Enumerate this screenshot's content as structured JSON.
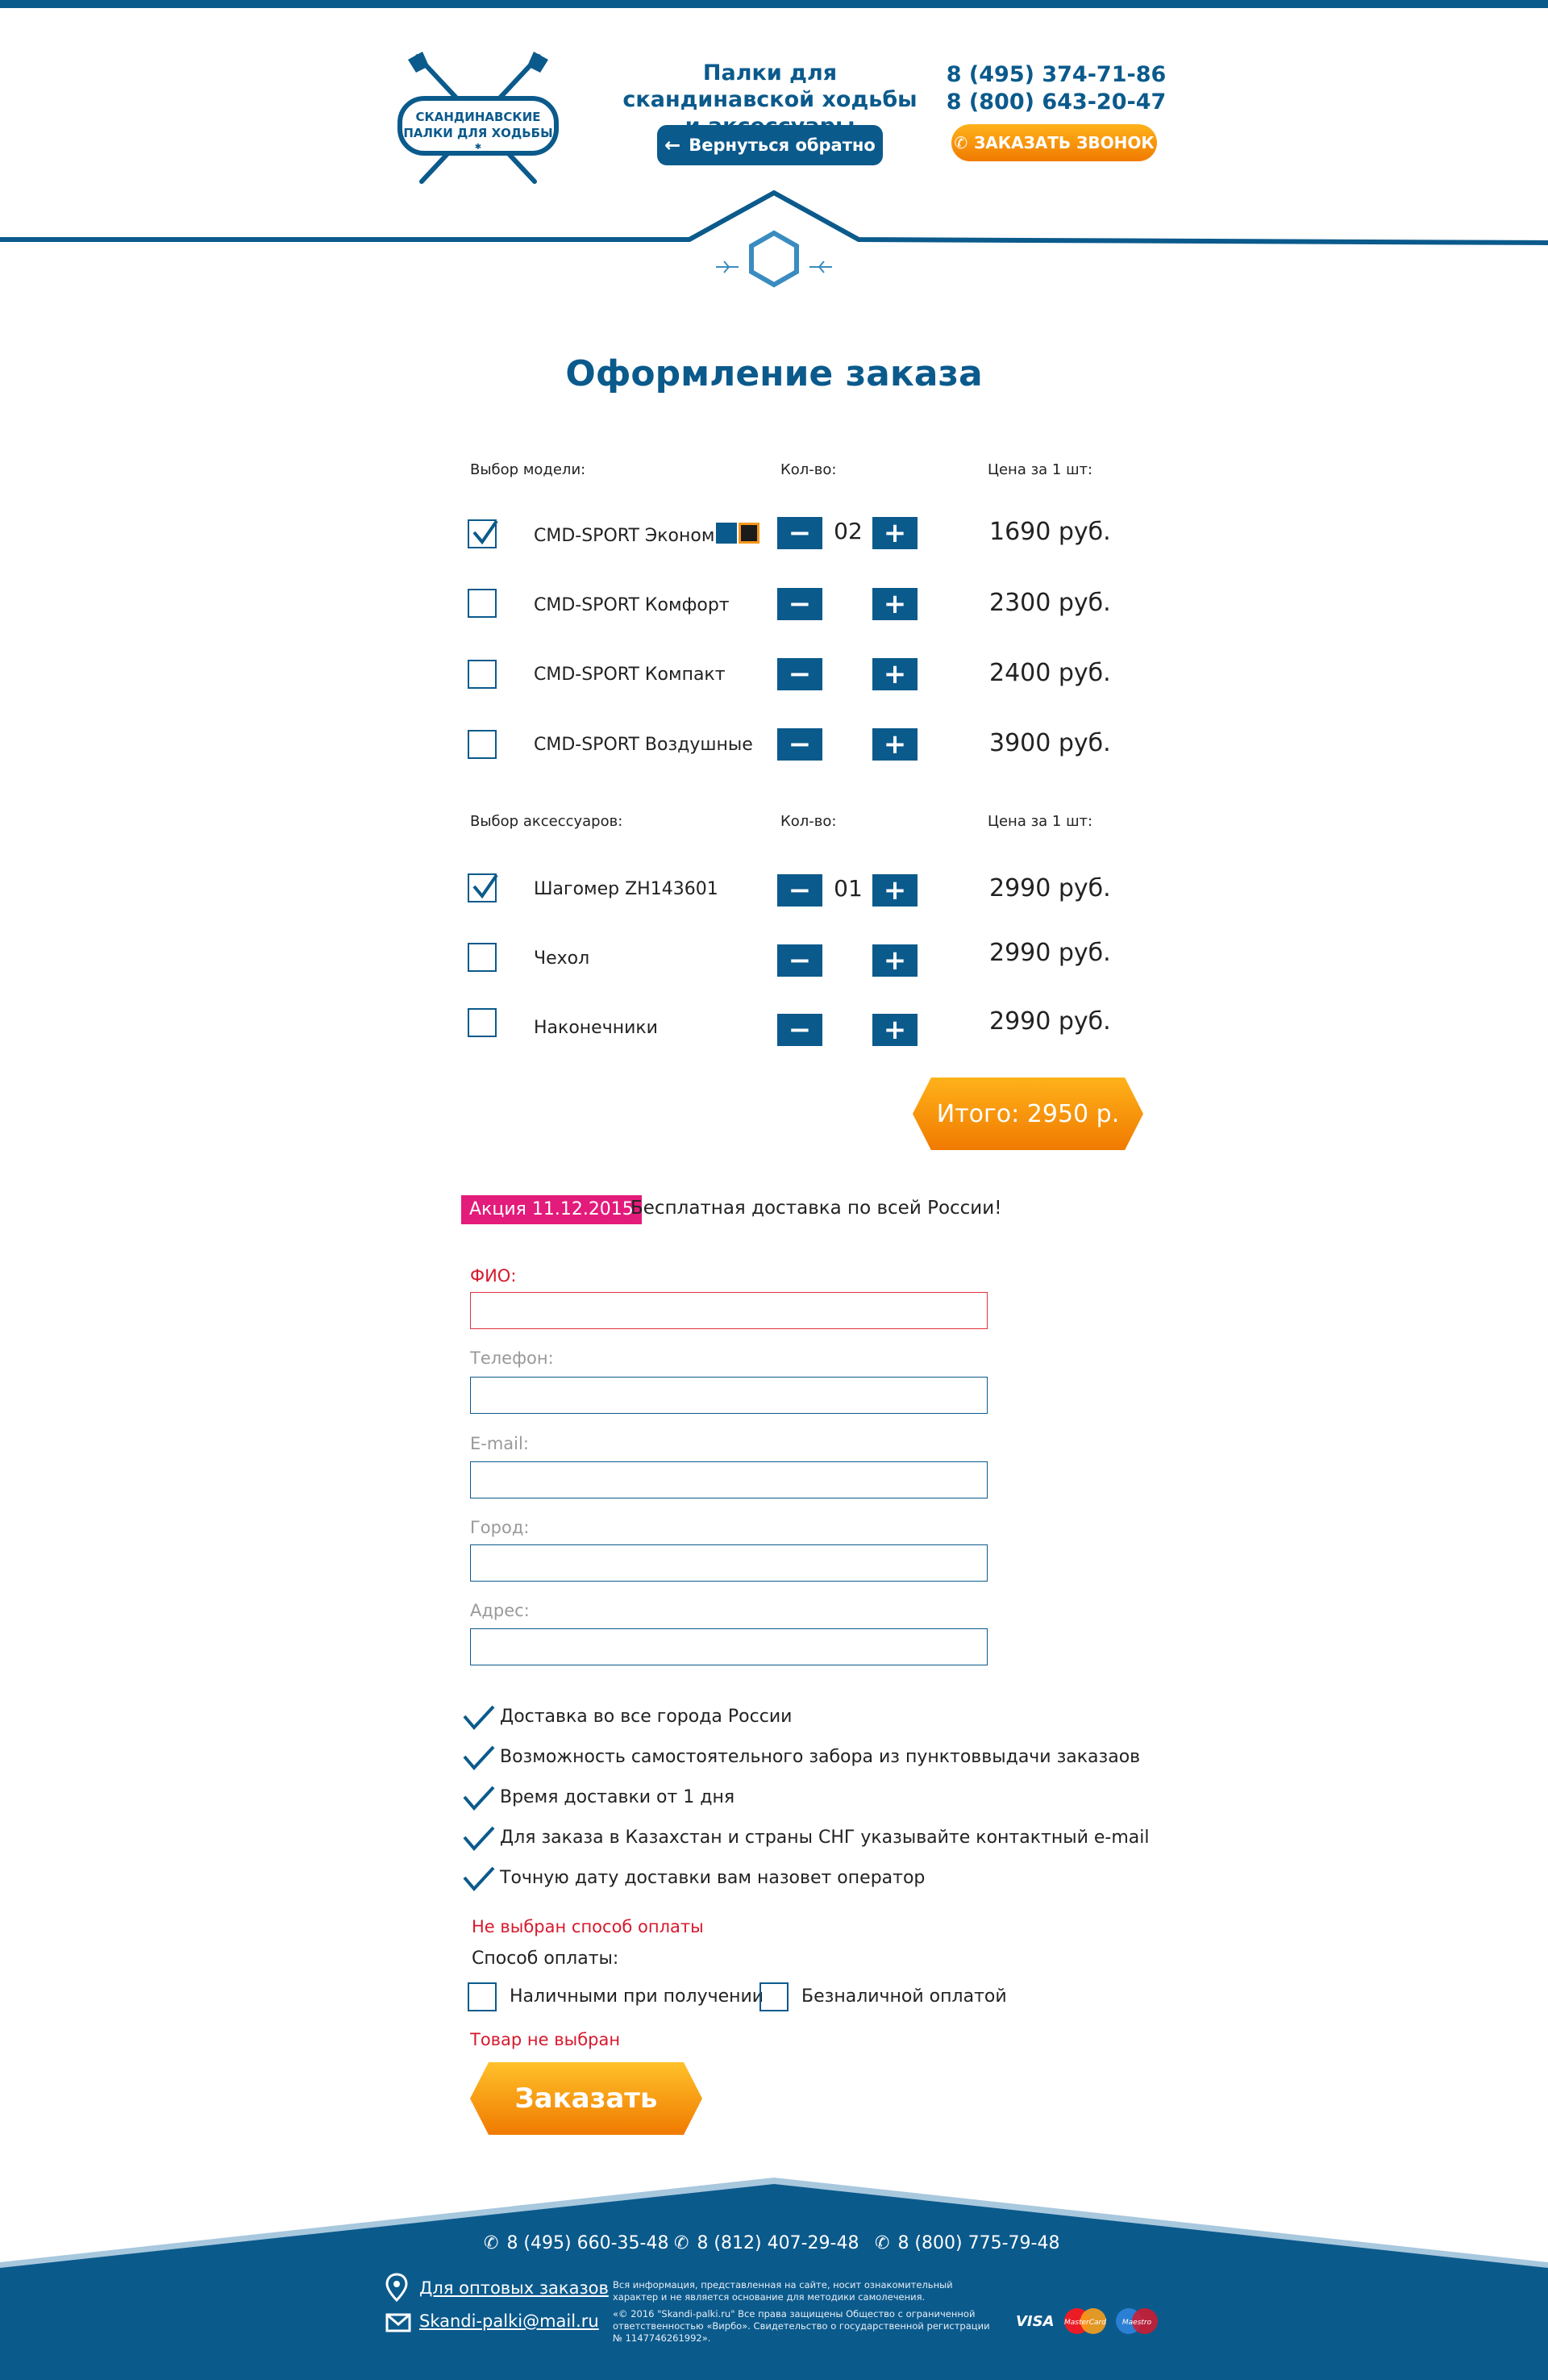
{
  "header": {
    "logo_text": [
      "СКАНДИНАВСКИЕ",
      "ПАЛКИ ДЛЯ ХОДЬБЫ"
    ],
    "tagline": "Палки для скандинавской ходьбы и аксессуары",
    "back_label": "Вернуться обратно",
    "phones": [
      "8 (495) 374-71-86",
      "8 (800) 643-20-47"
    ],
    "callback_label": "ЗАКАЗАТЬ ЗВОНОК"
  },
  "page_title": "Оформление заказа",
  "models": {
    "headers": {
      "name": "Выбор модели:",
      "qty": "Кол-во:",
      "price": "Цена за 1 шт:"
    },
    "items": [
      {
        "name": "CMD-SPORT Эконом",
        "checked": true,
        "qty": "02",
        "price": "1690 руб."
      },
      {
        "name": "CMD-SPORT Комфорт",
        "checked": false,
        "qty": "",
        "price": "2300 руб."
      },
      {
        "name": "CMD-SPORT Компакт",
        "checked": false,
        "qty": "",
        "price": "2400 руб."
      },
      {
        "name": "CMD-SPORT Воздушные",
        "checked": false,
        "qty": "",
        "price": "3900 руб."
      }
    ],
    "swatch_colors": [
      "#0b5a8c",
      "#1b1b1b"
    ]
  },
  "accessories": {
    "headers": {
      "name": "Выбор аксессуаров:",
      "qty": "Кол-во:",
      "price": "Цена за 1 шт:"
    },
    "items": [
      {
        "name": "Шагомер ZH143601",
        "checked": true,
        "qty": "01",
        "price": "2990 руб."
      },
      {
        "name": "Чехол",
        "checked": false,
        "qty": "",
        "price": "2990 руб."
      },
      {
        "name": "Наконечники",
        "checked": false,
        "qty": "",
        "price": "2990 руб."
      }
    ]
  },
  "qty_buttons": {
    "minus": "−",
    "plus": "+"
  },
  "total_label": "Итого: 2950 р.",
  "promo": {
    "badge": "Акция 11.12.2015",
    "text": "Бесплатная доставка по всей России!"
  },
  "form": {
    "fio_label": "ФИО:",
    "phone_label": "Телефон:",
    "email_label": "E-mail:",
    "city_label": "Город:",
    "address_label": "Адрес:"
  },
  "bullets": [
    "Доставка во все города России",
    "Возможность самостоятельного забора из пунктоввыдачи заказаов",
    "Время доставки от 1 дня",
    "Для заказа в Казахстан и страны СНГ указывайте контактный e-mail",
    "Точную дату доставки вам назовет оператор"
  ],
  "payment": {
    "error": "Не выбран способ оплаты",
    "label": "Способ оплаты:",
    "cash": "Наличными при получении",
    "cashless": "Безналичной оплатой"
  },
  "goods_error": "Товар не выбран",
  "order_label": "Заказать",
  "footer": {
    "phones": [
      "8 (495) 660-35-48",
      "8 (812) 407-29-48",
      "8 (800) 775-79-48"
    ],
    "wholesale_label": "Для оптовых заказов",
    "email": "Skandi-palki@mail.ru",
    "legal_1": "Вся информация, представленная на сайте, носит ознакомительный характер и не является основание для методики самолечения.",
    "legal_2": "«© 2016 \"Skandi-palki.ru\" Все права защищены Общество с ограниченной ответственностью «Вирбо». Свидетельство о государственной регистрации № 1147746261992».",
    "card_brands": [
      "VISA",
      "MasterCard",
      "Maestro"
    ]
  },
  "colors": {
    "brand": "#0b5a8c",
    "accent": "#f5951b",
    "error": "#d7192d",
    "promo": "#e31b7b"
  }
}
